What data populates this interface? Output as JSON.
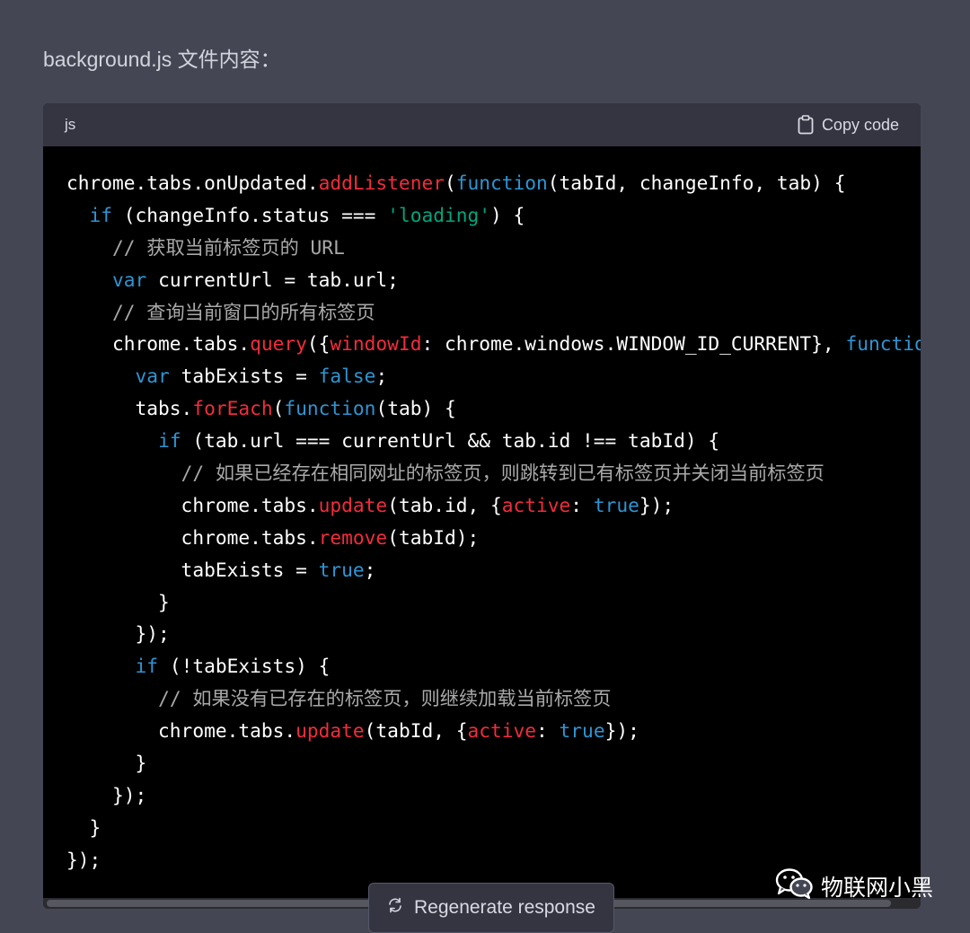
{
  "message": {
    "heading": "background.js 文件内容："
  },
  "code_block": {
    "language": "js",
    "copy_label": "Copy code",
    "lines": [
      [
        {
          "t": "chrome.tabs.onUpdated."
        },
        {
          "t": "addListener",
          "c": "f"
        },
        {
          "t": "("
        },
        {
          "t": "function",
          "c": "k"
        },
        {
          "t": "(tabId, changeInfo, tab) {"
        }
      ],
      [
        {
          "t": "  "
        },
        {
          "t": "if",
          "c": "k"
        },
        {
          "t": " (changeInfo.status === "
        },
        {
          "t": "'loading'",
          "c": "s"
        },
        {
          "t": ") {"
        }
      ],
      [
        {
          "t": "    "
        },
        {
          "t": "// 获取当前标签页的 URL",
          "c": "c"
        }
      ],
      [
        {
          "t": "    "
        },
        {
          "t": "var",
          "c": "k"
        },
        {
          "t": " currentUrl = tab.url;"
        }
      ],
      [
        {
          "t": "    "
        },
        {
          "t": "// 查询当前窗口的所有标签页",
          "c": "c"
        }
      ],
      [
        {
          "t": "    chrome.tabs."
        },
        {
          "t": "query",
          "c": "f"
        },
        {
          "t": "({"
        },
        {
          "t": "windowId",
          "c": "f"
        },
        {
          "t": ": chrome.windows.WINDOW_ID_CURRENT}, "
        },
        {
          "t": "function",
          "c": "k"
        }
      ],
      [
        {
          "t": "      "
        },
        {
          "t": "var",
          "c": "k"
        },
        {
          "t": " tabExists = "
        },
        {
          "t": "false",
          "c": "k"
        },
        {
          "t": ";"
        }
      ],
      [
        {
          "t": "      tabs."
        },
        {
          "t": "forEach",
          "c": "f"
        },
        {
          "t": "("
        },
        {
          "t": "function",
          "c": "k"
        },
        {
          "t": "(tab) {"
        }
      ],
      [
        {
          "t": "        "
        },
        {
          "t": "if",
          "c": "k"
        },
        {
          "t": " (tab.url === currentUrl && tab.id !== tabId) {"
        }
      ],
      [
        {
          "t": "          "
        },
        {
          "t": "// 如果已经存在相同网址的标签页，则跳转到已有标签页并关闭当前标签页",
          "c": "c"
        }
      ],
      [
        {
          "t": "          chrome.tabs."
        },
        {
          "t": "update",
          "c": "f"
        },
        {
          "t": "(tab.id, {"
        },
        {
          "t": "active",
          "c": "f"
        },
        {
          "t": ": "
        },
        {
          "t": "true",
          "c": "k"
        },
        {
          "t": "});"
        }
      ],
      [
        {
          "t": "          chrome.tabs."
        },
        {
          "t": "remove",
          "c": "f"
        },
        {
          "t": "(tabId);"
        }
      ],
      [
        {
          "t": "          tabExists = "
        },
        {
          "t": "true",
          "c": "k"
        },
        {
          "t": ";"
        }
      ],
      [
        {
          "t": "        }"
        }
      ],
      [
        {
          "t": "      });"
        }
      ],
      [
        {
          "t": "      "
        },
        {
          "t": "if",
          "c": "k"
        },
        {
          "t": " (!tabExists) {"
        }
      ],
      [
        {
          "t": "        "
        },
        {
          "t": "// 如果没有已存在的标签页，则继续加载当前标签页",
          "c": "c"
        }
      ],
      [
        {
          "t": "        chrome.tabs."
        },
        {
          "t": "update",
          "c": "f"
        },
        {
          "t": "(tabId, {"
        },
        {
          "t": "active",
          "c": "f"
        },
        {
          "t": ": "
        },
        {
          "t": "true",
          "c": "k"
        },
        {
          "t": "});"
        }
      ],
      [
        {
          "t": "      }"
        }
      ],
      [
        {
          "t": "    });"
        }
      ],
      [
        {
          "t": "  }"
        }
      ],
      [
        {
          "t": "});"
        }
      ]
    ]
  },
  "regenerate": {
    "label": "Regenerate response",
    "icon": "refresh-icon"
  },
  "watermark": {
    "text": "物联网小黑",
    "icon": "wechat-icon"
  },
  "colors": {
    "page_bg": "#444654",
    "code_bg": "#000000",
    "header_bg": "#343541",
    "keyword": "#2e95d3",
    "function": "#f22c3d",
    "string": "#00a67d",
    "comment": "#a9a9a9"
  }
}
